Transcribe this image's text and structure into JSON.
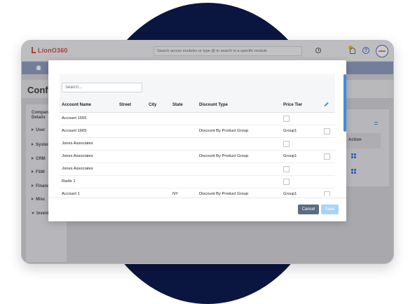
{
  "app": {
    "logo_text": "LionO360",
    "brand_color": "#c0392b",
    "global_search_placeholder": "Search across modules or type @ to search in a specific module",
    "page_title": "Configuration"
  },
  "sidebar": {
    "company_label": "Company Details",
    "items": [
      {
        "label": "User",
        "icon": "caret-right-icon"
      },
      {
        "label": "System",
        "icon": "caret-right-icon"
      },
      {
        "label": "CRM",
        "icon": "caret-right-icon"
      },
      {
        "label": "FSM",
        "icon": "caret-right-icon"
      },
      {
        "label": "Finance",
        "icon": "caret-right-icon"
      },
      {
        "label": "Misc",
        "icon": "caret-right-icon"
      },
      {
        "label": "Inventory",
        "icon": "caret-down-icon"
      }
    ]
  },
  "right_panel": {
    "column_label": "Action"
  },
  "modal": {
    "search_placeholder": "Search...",
    "columns": [
      "Account Name",
      "Street",
      "City",
      "State",
      "Discount Type",
      "Price Tier"
    ],
    "rows": [
      {
        "account": "Account 1555",
        "street": "",
        "city": "",
        "state": "",
        "discount": "",
        "tier": "",
        "checked": false
      },
      {
        "account": "Account 1665",
        "street": "",
        "city": "",
        "state": "",
        "discount": "Discount By Product Group",
        "tier": "Group1",
        "checked": false
      },
      {
        "account": "Jones Associates",
        "street": "",
        "city": "",
        "state": "",
        "discount": "",
        "tier": "",
        "checked": false
      },
      {
        "account": "Jones Associates",
        "street": "",
        "city": "",
        "state": "",
        "discount": "Discount By Product Group",
        "tier": "Group1",
        "checked": false
      },
      {
        "account": "Jones Associates",
        "street": "",
        "city": "",
        "state": "",
        "discount": "",
        "tier": "",
        "checked": false
      },
      {
        "account": "Radix 1",
        "street": "",
        "city": "",
        "state": "",
        "discount": "",
        "tier": "",
        "checked": false
      },
      {
        "account": "Account 1",
        "street": "",
        "city": "",
        "state": "NY",
        "discount": "Discount By Product Group",
        "tier": "Group1",
        "checked": false
      }
    ],
    "cancel_label": "Cancel",
    "save_label": "Save",
    "accent_color": "#3b8fe0"
  }
}
